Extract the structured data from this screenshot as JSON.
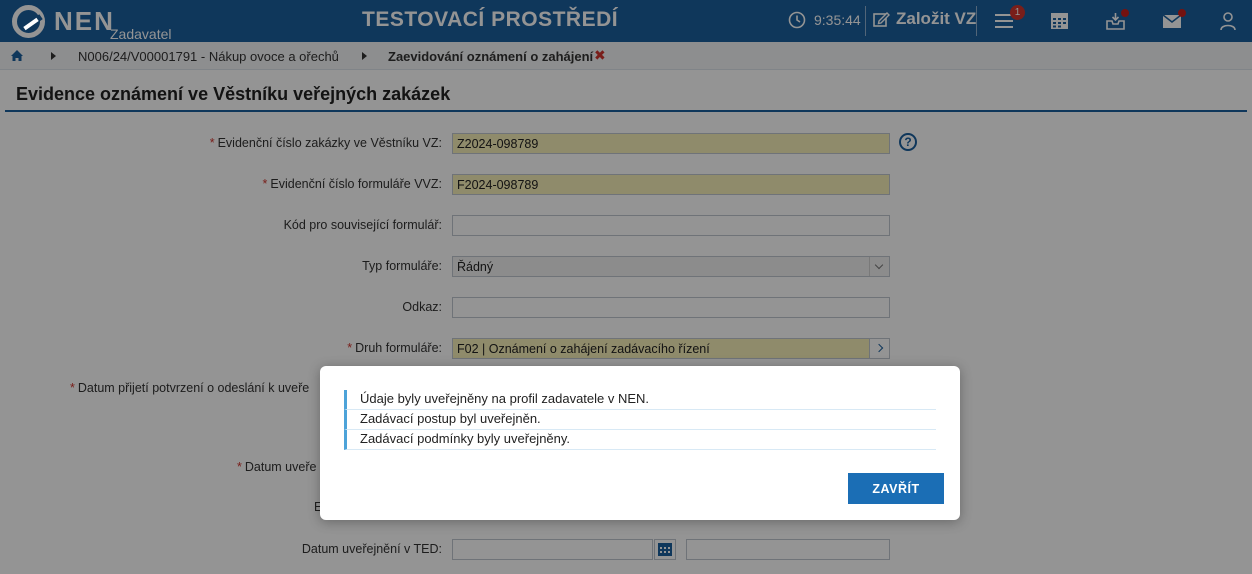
{
  "header": {
    "logo_text": "NEN",
    "logo_sub": "Zadavatel",
    "environment_title": "TESTOVACÍ PROSTŘEDÍ",
    "clock": "9:35:44",
    "create_button": "Založit VZ",
    "notification_count": "1",
    "icons": [
      "clock-icon",
      "edit-icon",
      "menu-icon",
      "calendar-icon",
      "inbox-icon",
      "mail-icon",
      "user-icon"
    ],
    "bg_color": "#1b5f9e"
  },
  "breadcrumb": {
    "item1": "N006/24/V00001791 - Nákup ovoce a ořechů",
    "item2": "Zaevidování oznámení o zahájení",
    "close_glyph": "✖"
  },
  "page": {
    "title": "Evidence oznámení ve Věstníku veřejných zakázek"
  },
  "form": {
    "ev_cislo_zakazky_label": "Evidenční číslo zakázky ve Věstníku VZ:",
    "ev_cislo_zakazky_value": "Z2024-098789",
    "ev_cislo_formulare_label": "Evidenční číslo formuláře VVZ:",
    "ev_cislo_formulare_value": "F2024-098789",
    "kod_souvisejici_label": "Kód pro související formulář:",
    "kod_souvisejici_value": "",
    "typ_formulare_label": "Typ formuláře:",
    "typ_formulare_value": "Řádný",
    "odkaz_label": "Odkaz:",
    "odkaz_value": "",
    "druh_formulare_label": "Druh formuláře:",
    "druh_formulare_value": "F02 | Oznámení o zahájení zadávacího řízení",
    "datum_prijeti_label": "Datum přijetí potvrzení o odeslání k uveře",
    "datum_uver_label": "Datum uveře",
    "partial_e": "E",
    "datum_ted_label": "Datum uveřejnění v TED:",
    "datum_ted_value": "",
    "datum_ted_time": ""
  },
  "modal": {
    "messages": [
      "Údaje byly uveřejněny na profil zadavatele v NEN.",
      "Zadávací postup byl uveřejněn.",
      "Zadávací podmínky byly uveřejněny."
    ],
    "close_label": "ZAVŘÍT"
  },
  "colors": {
    "accent": "#1b5f9e",
    "required_field": "#f7efb8",
    "error_red": "#d0352d",
    "message_border": "#4da3d9"
  }
}
